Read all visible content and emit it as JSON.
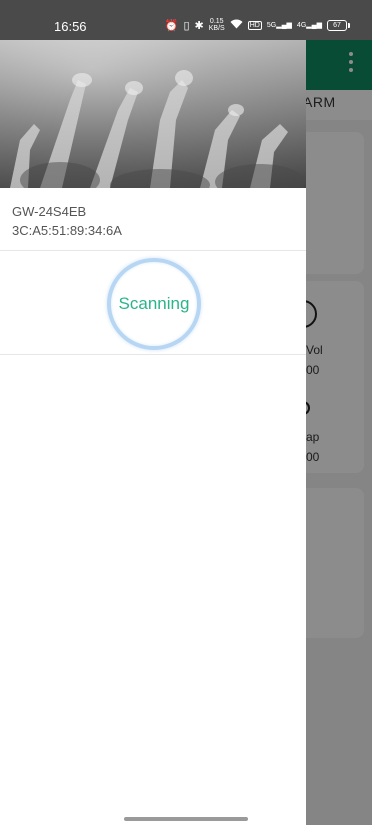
{
  "status_bar": {
    "time": "16:56",
    "net_speed_value": "0.15",
    "net_speed_unit": "KB/S",
    "hd_label": "HD",
    "signal1_label": "5G",
    "signal2_label": "4G",
    "battery_level": "67"
  },
  "background_app": {
    "tab_label": "ARM",
    "vol_label": "Vol",
    "vol_value": "00",
    "ap_label": "ap",
    "ap_value": "00"
  },
  "drawer": {
    "device_name": "GW-24S4EB",
    "device_mac": "3C:A5:51:89:34:6A",
    "scan_label": "Scanning"
  },
  "colors": {
    "accent_green": "#2bb38a",
    "appbar_green": "#0f8a63",
    "scan_ring": "#b7d6f3"
  }
}
